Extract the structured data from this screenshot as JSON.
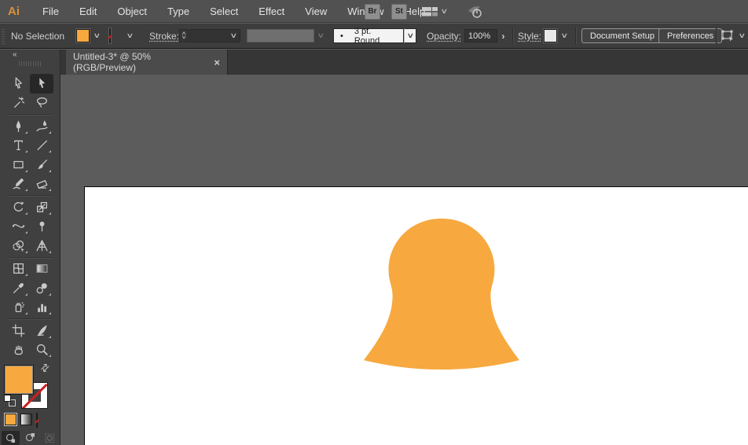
{
  "app": {
    "logo_text": "Ai"
  },
  "menu_bar": {
    "items": [
      "File",
      "Edit",
      "Object",
      "Type",
      "Select",
      "Effect",
      "View",
      "Window",
      "Help"
    ],
    "bridge_label": "Br",
    "stock_label": "St"
  },
  "control_bar": {
    "selection_status": "No Selection",
    "stroke_label": "Stroke:",
    "brush_preview_glyph": "•",
    "brush_name": "3 pt. Round",
    "opacity_label": "Opacity:",
    "opacity_value": "100%",
    "style_label": "Style:",
    "document_setup_label": "Document Setup",
    "preferences_label": "Preferences"
  },
  "tab_bar": {
    "active_tab": {
      "title": "Untitled-3* @ 50% (RGB/Preview)"
    }
  },
  "toolbar": {
    "tools": [
      "selection",
      "direct-selection",
      "magic-wand",
      "lasso",
      "pen",
      "curvature",
      "type",
      "line-segment",
      "rectangle",
      "paintbrush",
      "shaper",
      "eraser",
      "rotate",
      "scale",
      "width",
      "puppet-warp",
      "shape-builder",
      "perspective-grid",
      "mesh",
      "gradient",
      "eyedropper",
      "blend",
      "symbol-sprayer",
      "column-graph",
      "artboard",
      "slice",
      "hand",
      "zoom"
    ],
    "active_tool": "direct-selection",
    "fill_color": "#F7A83E",
    "stroke_color": "none"
  },
  "icons": {
    "chevron_down": "∨",
    "chevron_up": "∧",
    "swap": "⇄",
    "panel_arrow": "›",
    "close": "×",
    "collapse": "«"
  },
  "canvas": {
    "shape": {
      "type": "bell-silhouette",
      "fill": "#F7A83E",
      "zoom_percent": "50%"
    }
  },
  "colors": {
    "accent_orange": "#F7A83E",
    "none_slash_red": "#C9201F",
    "menu_bar_bg": "#515151",
    "control_bar_bg": "#3D3D3D",
    "panel_bg": "#404040",
    "tab_bar_bg": "#363636",
    "canvas_bg": "#5C5C5C",
    "artboard_bg": "#FFFFFF"
  }
}
